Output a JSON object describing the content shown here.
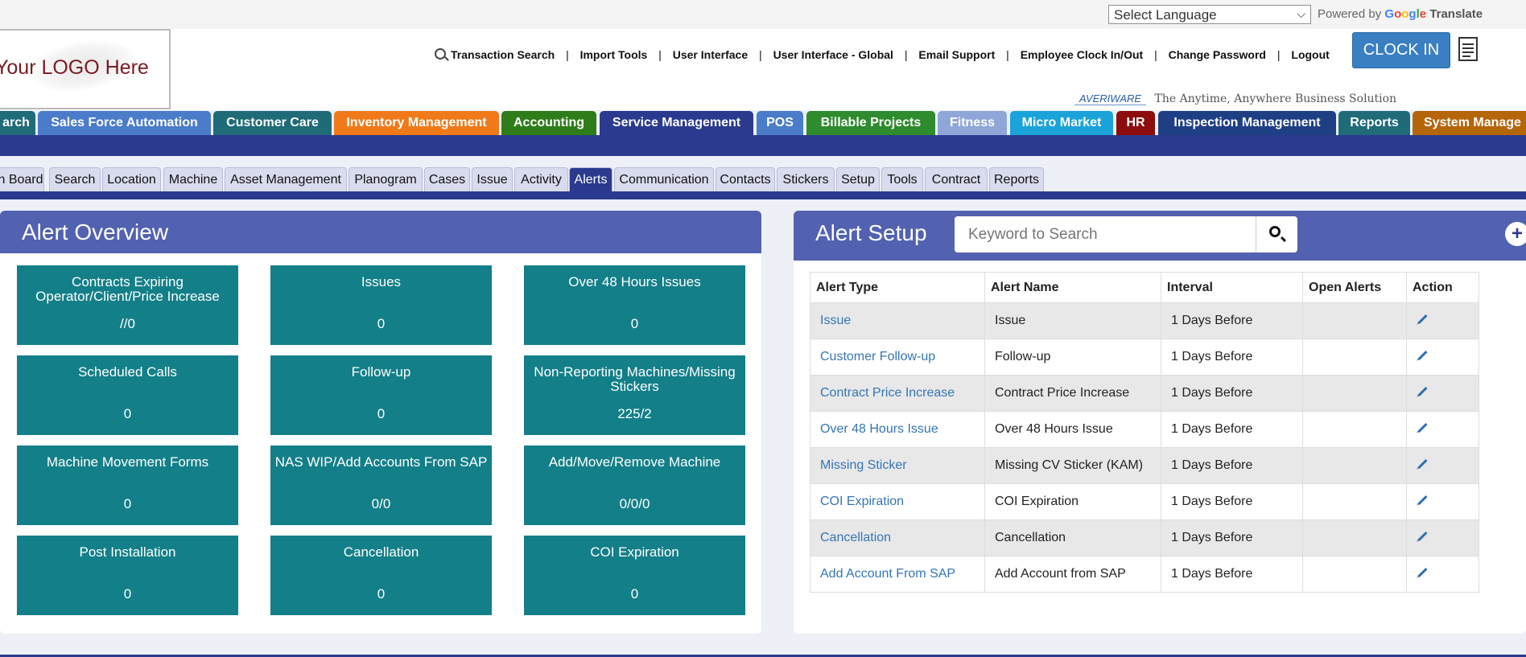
{
  "google_translate": {
    "select_language": "Select Language",
    "powered_by": "Powered by",
    "google": "Google",
    "translate": "Translate"
  },
  "logo": {
    "text": "Your LOGO Here"
  },
  "top_links": {
    "transaction_search": "Transaction Search",
    "import_tools": "Import Tools",
    "user_interface": "User Interface",
    "user_interface_global": "User Interface - Global",
    "email_support": "Email Support",
    "employee_clock": "Employee Clock In/Out",
    "change_password": "Change Password",
    "logout": "Logout",
    "separator": "|"
  },
  "clock_in": {
    "label": "CLOCK IN"
  },
  "averiware": {
    "brand": "AVERIWARE",
    "tagline": "The Anytime, Anywhere Business Solution"
  },
  "main_nav": [
    {
      "label": "arch",
      "color": "#1f6b78"
    },
    {
      "label": "Sales Force Automation",
      "color": "#4a7cc9"
    },
    {
      "label": "Customer Care",
      "color": "#1f6b78"
    },
    {
      "label": "Inventory Management",
      "color": "#f07a1a"
    },
    {
      "label": "Accounting",
      "color": "#2e7d1a"
    },
    {
      "label": "Service Management",
      "color": "#2b3a8e"
    },
    {
      "label": "POS",
      "color": "#4a7cc9"
    },
    {
      "label": "Billable Projects",
      "color": "#2e8b2e"
    },
    {
      "label": "Fitness",
      "color": "#8fa6d8"
    },
    {
      "label": "Micro Market",
      "color": "#1aa3d8"
    },
    {
      "label": "HR",
      "color": "#8b0d0d"
    },
    {
      "label": "Inspection Management",
      "color": "#1f3f85"
    },
    {
      "label": "Reports",
      "color": "#1f6b78"
    },
    {
      "label": "System Manage",
      "color": "#b5650a"
    }
  ],
  "sub_nav": [
    {
      "label": "n Board"
    },
    {
      "label": "Search"
    },
    {
      "label": "Location"
    },
    {
      "label": "Machine"
    },
    {
      "label": "Asset Management"
    },
    {
      "label": "Planogram"
    },
    {
      "label": "Cases"
    },
    {
      "label": "Issue"
    },
    {
      "label": "Activity"
    },
    {
      "label": "Alerts"
    },
    {
      "label": "Communication"
    },
    {
      "label": "Contacts"
    },
    {
      "label": "Stickers"
    },
    {
      "label": "Setup"
    },
    {
      "label": "Tools"
    },
    {
      "label": "Contract"
    },
    {
      "label": "Reports"
    }
  ],
  "alert_overview": {
    "title": "Alert Overview",
    "cards": [
      {
        "title": "Contracts Expiring Operator/Client/Price Increase",
        "value": "//0"
      },
      {
        "title": "Issues",
        "value": "0"
      },
      {
        "title": "Over 48 Hours Issues",
        "value": "0"
      },
      {
        "title": "Scheduled Calls",
        "value": "0"
      },
      {
        "title": "Follow-up",
        "value": "0"
      },
      {
        "title": "Non-Reporting Machines/Missing Stickers",
        "value": "225/2"
      },
      {
        "title": "Machine Movement Forms",
        "value": "0"
      },
      {
        "title": "NAS WIP/Add Accounts From SAP",
        "value": "0/0"
      },
      {
        "title": "Add/Move/Remove Machine",
        "value": "0/0/0"
      },
      {
        "title": "Post Installation",
        "value": "0"
      },
      {
        "title": "Cancellation",
        "value": "0"
      },
      {
        "title": "COI Expiration",
        "value": "0"
      }
    ]
  },
  "alert_setup": {
    "title": "Alert Setup",
    "search_placeholder": "Keyword to Search",
    "add_icon": "+",
    "columns": [
      "Alert Type",
      "Alert Name",
      "Interval",
      "Open Alerts",
      "Action"
    ],
    "rows": [
      {
        "type": "Issue",
        "name": "Issue",
        "interval": "1 Days Before",
        "open": ""
      },
      {
        "type": "Customer Follow-up",
        "name": "Follow-up",
        "interval": "1 Days Before",
        "open": ""
      },
      {
        "type": "Contract Price Increase",
        "name": "Contract Price Increase",
        "interval": "1 Days Before",
        "open": ""
      },
      {
        "type": "Over 48 Hours Issue",
        "name": "Over 48 Hours Issue",
        "interval": "1 Days Before",
        "open": ""
      },
      {
        "type": "Missing Sticker",
        "name": "Missing CV Sticker (KAM)",
        "interval": "1 Days Before",
        "open": ""
      },
      {
        "type": "COI Expiration",
        "name": "COI Expiration",
        "interval": "1 Days Before",
        "open": ""
      },
      {
        "type": "Cancellation",
        "name": "Cancellation",
        "interval": "1 Days Before",
        "open": ""
      },
      {
        "type": "Add Account From SAP",
        "name": "Add Account from SAP",
        "interval": "1 Days Before",
        "open": ""
      }
    ]
  }
}
